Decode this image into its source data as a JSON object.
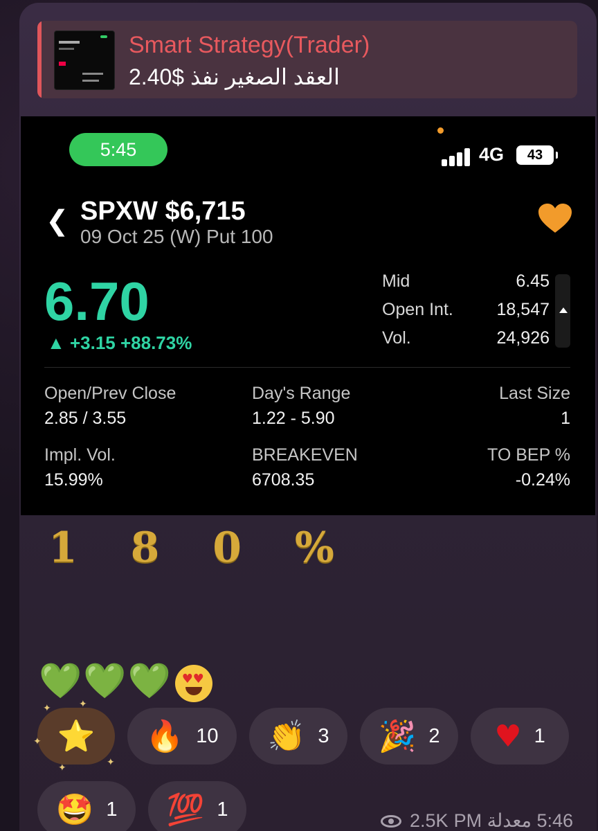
{
  "reply": {
    "sender": "Smart Strategy(Trader)",
    "text": "العقد الصغير نفذ $2.40"
  },
  "screenshot": {
    "status_time": "5:45",
    "network": "4G",
    "battery": "43",
    "symbol": "SPXW $6,715",
    "contract": "09 Oct 25 (W) Put 100",
    "price": "6.70",
    "change": "+3.15 +88.73%",
    "stats": [
      {
        "label": "Mid",
        "value": "6.45"
      },
      {
        "label": "Open Int.",
        "value": "18,547"
      },
      {
        "label": "Vol.",
        "value": "24,926"
      }
    ],
    "grid": [
      {
        "label": "Open/Prev Close",
        "value": "2.85 / 3.55"
      },
      {
        "label": "Day's Range",
        "value": "1.22 - 5.90"
      },
      {
        "label": "Last Size",
        "value": "1"
      },
      {
        "label": "Impl. Vol.",
        "value": "15.99%"
      },
      {
        "label": "BREAKEVEN",
        "value": "6708.35"
      },
      {
        "label": "TO BEP %",
        "value": "-0.24%"
      }
    ],
    "colors": {
      "positive": "#2fd4a4",
      "favorite": "#f29b2b",
      "status_pill": "#34c759"
    }
  },
  "message": {
    "headline": "1 8 0 %",
    "emoji": "💚💚💚"
  },
  "reactions": [
    {
      "emoji": "⭐",
      "icon": "star-icon",
      "count": ""
    },
    {
      "emoji": "🔥",
      "icon": "fire-icon",
      "count": "10"
    },
    {
      "emoji": "👏",
      "icon": "clap-icon",
      "count": "3"
    },
    {
      "emoji": "🎉",
      "icon": "party-popper-icon",
      "count": "2"
    },
    {
      "emoji": "♥",
      "icon": "heart-icon",
      "count": "1"
    },
    {
      "emoji": "🤩",
      "icon": "star-struck-icon",
      "count": "1"
    },
    {
      "emoji": "💯",
      "icon": "hundred-icon",
      "count": "1"
    }
  ],
  "meta": {
    "views": "2.5K",
    "time": "5:46 معدلة PM"
  }
}
